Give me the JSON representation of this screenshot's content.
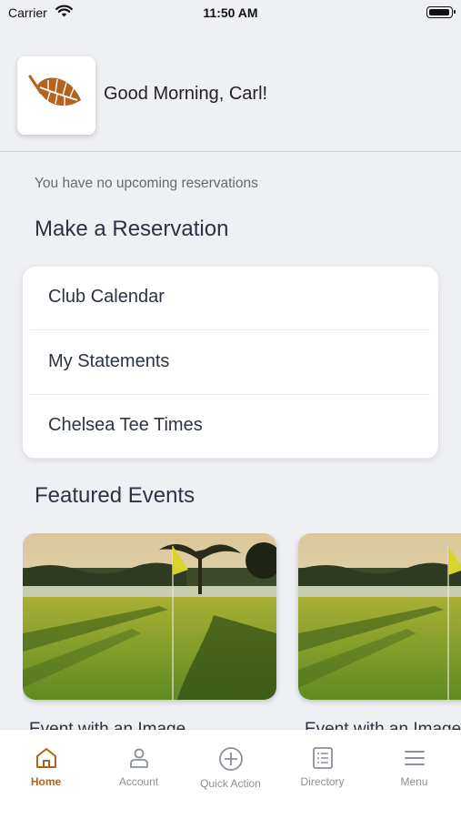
{
  "status_bar": {
    "carrier": "Carrier",
    "time": "11:50 AM"
  },
  "header": {
    "greeting": "Good Morning, Carl!",
    "logo_icon": "leaf-icon",
    "logo_color": "#b4631c"
  },
  "reservations": {
    "empty_message": "You have no upcoming reservations"
  },
  "make_reservation": {
    "title": "Make a Reservation",
    "items": [
      {
        "label": "Club Calendar"
      },
      {
        "label": "My Statements"
      },
      {
        "label": "Chelsea Tee Times"
      }
    ]
  },
  "featured_events": {
    "title": "Featured Events",
    "events": [
      {
        "title": "Event with an Image"
      },
      {
        "title": "Event with an Image"
      }
    ]
  },
  "tab_bar": {
    "active_color": "#b4631c",
    "tabs": [
      {
        "label": "Home",
        "icon": "home-icon",
        "active": true
      },
      {
        "label": "Account",
        "icon": "account-icon",
        "active": false
      },
      {
        "label": "Quick Action",
        "icon": "plus-circle-icon",
        "active": false
      },
      {
        "label": "Directory",
        "icon": "directory-icon",
        "active": false
      },
      {
        "label": "Menu",
        "icon": "menu-icon",
        "active": false
      }
    ]
  }
}
